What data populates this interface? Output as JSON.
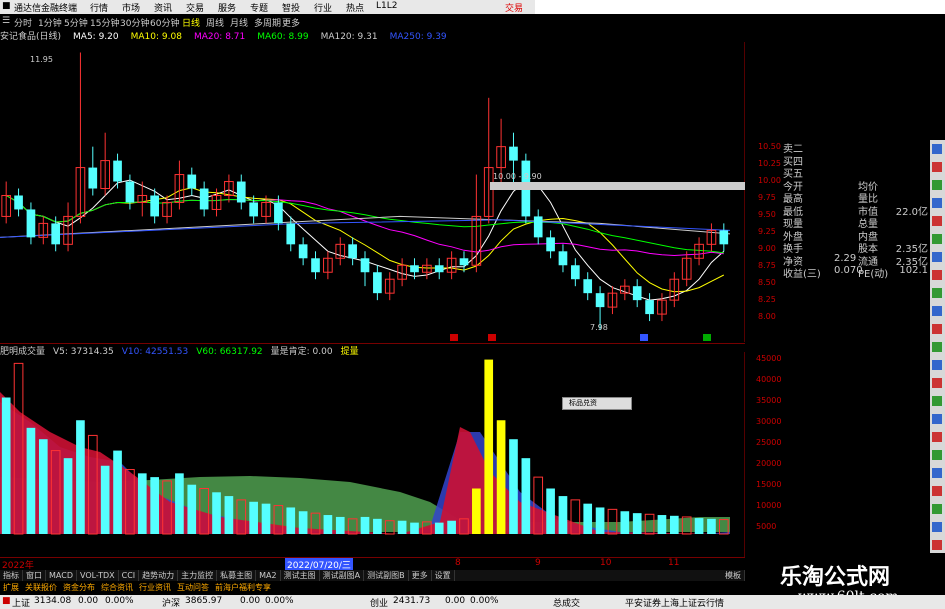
{
  "titlebar": {
    "app_title": "通达信金融终端",
    "menu": [
      "行情",
      "市场",
      "资讯",
      "交易",
      "服务",
      "专题",
      "智投",
      "行业",
      "热点",
      "L1L2"
    ],
    "trade_label": "交易"
  },
  "periods": [
    "分时",
    "1分钟",
    "5分钟",
    "15分钟",
    "30分钟",
    "60分钟",
    "日线",
    "周线",
    "月线",
    "多周期",
    "更多"
  ],
  "period_selected": "日线",
  "stock_label": "安记食品(日线)",
  "ma_items": [
    {
      "label": "MA5: 9.20",
      "color": "#ffffff"
    },
    {
      "label": "MA10: 9.08",
      "color": "#ffff00"
    },
    {
      "label": "MA20: 8.71",
      "color": "#ff00ff"
    },
    {
      "label": "MA60: 8.99",
      "color": "#00ff00"
    },
    {
      "label": "MA120: 9.31",
      "color": "#cccccc"
    },
    {
      "label": "MA250: 9.39",
      "color": "#3355ff"
    }
  ],
  "annotations": {
    "high": "11.95",
    "low": "7.98",
    "box": "10.00 - 9.90"
  },
  "kline_yaxis": [
    "10.50",
    "10.25",
    "10.00",
    "9.75",
    "9.50",
    "9.25",
    "9.00",
    "8.75",
    "8.50",
    "8.25",
    "8.00"
  ],
  "vol_header": [
    {
      "label": "肥明成交量",
      "color": "#cccccc"
    },
    {
      "label": "V5: 37314.35",
      "color": "#cccccc"
    },
    {
      "label": "V10: 42551.53",
      "color": "#3355ff"
    },
    {
      "label": "V60: 66317.92",
      "color": "#00ff00"
    },
    {
      "label": "量是肯定: 0.00",
      "color": "#cccccc"
    },
    {
      "label": "提量",
      "color": "#ffff00"
    }
  ],
  "vol_yaxis": [
    "45000",
    "40000",
    "35000",
    "30000",
    "25000",
    "20000",
    "15000",
    "10000",
    "5000"
  ],
  "popup_label": "标品兑资",
  "xaxis": {
    "labels": [
      "2022年",
      "8",
      "9",
      "10",
      "11"
    ],
    "highlight_date": "2022/07/20/三"
  },
  "indicator_tabs": [
    "指标",
    "窗口",
    "MACD",
    "VOL-TDX",
    "CCI",
    "趋势动力",
    "主力监控",
    "私募主图",
    "MA2",
    "测试主图",
    "测试副图A",
    "测试副图B",
    "更多",
    "设置"
  ],
  "indicator_right": "模板",
  "bottom_tabs": [
    "扩展",
    "关联报价",
    "资金分布",
    "综合资讯",
    "行业资讯",
    "互动问答",
    "前海户福利专享"
  ],
  "info_panel": [
    {
      "label": "卖二",
      "mid": "",
      "v1": "",
      "v2": ""
    },
    {
      "label": "买四",
      "mid": "",
      "v1": "",
      "v2": ""
    },
    {
      "label": "买五",
      "mid": "",
      "v1": "",
      "v2": ""
    },
    {
      "label": "今开",
      "mid": "均价",
      "v1": "",
      "v2": ""
    },
    {
      "label": "最高",
      "mid": "量比",
      "v1": "",
      "v2": ""
    },
    {
      "label": "最低",
      "mid": "市值",
      "v1": "",
      "v2": "22.0亿"
    },
    {
      "label": "现量",
      "mid": "总量",
      "v1": "",
      "v2": ""
    },
    {
      "label": "外盘",
      "mid": "内盘",
      "v1": "",
      "v2": ""
    },
    {
      "label": "换手",
      "mid": "股本",
      "v1": "",
      "v2": "2.35亿"
    },
    {
      "label": "净资",
      "mid": "流通",
      "v1": "2.29",
      "v2": "2.35亿"
    },
    {
      "label": "收益(三)",
      "mid": "PE(动)",
      "v1": "0.070",
      "v2": "102.1"
    }
  ],
  "status": {
    "sh_label": "上证",
    "sh_value": "3134.08",
    "sh_chg": "0.00",
    "sh_pct": "0.00%",
    "hs_label": "沪深",
    "hs_value": "3865.97",
    "hs_chg": "0.00",
    "hs_pct": "0.00%",
    "cy_label": "创业",
    "cy_value": "2431.73",
    "cy_chg": "0.00",
    "cy_pct": "0.00%",
    "vol_label": "总成交",
    "right_text": "平安证券上海上证云行情"
  },
  "watermark": {
    "line1": "乐淘公式网",
    "line2": "www.60lt.com"
  },
  "colors": {
    "up": "#ff3333",
    "down": "#55ffff",
    "bg": "#000000",
    "axis": "#aa0000"
  },
  "kline_data": {
    "type": "candlestick",
    "candles": [
      [
        9.6,
        9.9,
        9.5,
        10.1
      ],
      [
        9.9,
        9.7,
        9.6,
        10.0
      ],
      [
        9.7,
        9.3,
        9.2,
        9.8
      ],
      [
        9.3,
        9.5,
        9.2,
        9.6
      ],
      [
        9.5,
        9.2,
        9.1,
        9.6
      ],
      [
        9.2,
        9.6,
        9.1,
        9.8
      ],
      [
        9.6,
        10.3,
        9.5,
        11.95
      ],
      [
        10.3,
        10.0,
        9.9,
        10.6
      ],
      [
        10.0,
        10.4,
        9.9,
        10.8
      ],
      [
        10.4,
        10.1,
        10.0,
        10.5
      ],
      [
        10.1,
        9.8,
        9.7,
        10.2
      ],
      [
        9.8,
        9.9,
        9.6,
        10.1
      ],
      [
        9.9,
        9.6,
        9.5,
        10.0
      ],
      [
        9.6,
        9.8,
        9.5,
        9.9
      ],
      [
        9.8,
        10.2,
        9.7,
        10.4
      ],
      [
        10.2,
        10.0,
        9.9,
        10.3
      ],
      [
        10.0,
        9.7,
        9.6,
        10.1
      ],
      [
        9.7,
        9.9,
        9.6,
        10.0
      ],
      [
        9.9,
        10.1,
        9.8,
        10.2
      ],
      [
        10.1,
        9.8,
        9.7,
        10.2
      ],
      [
        9.8,
        9.6,
        9.5,
        9.9
      ],
      [
        9.6,
        9.8,
        9.5,
        9.9
      ],
      [
        9.8,
        9.5,
        9.4,
        9.9
      ],
      [
        9.5,
        9.2,
        9.1,
        9.6
      ],
      [
        9.2,
        9.0,
        8.9,
        9.3
      ],
      [
        9.0,
        8.8,
        8.7,
        9.1
      ],
      [
        8.8,
        9.0,
        8.7,
        9.1
      ],
      [
        9.0,
        9.2,
        8.9,
        9.3
      ],
      [
        9.2,
        9.0,
        8.9,
        9.3
      ],
      [
        9.0,
        8.8,
        8.6,
        9.1
      ],
      [
        8.8,
        8.5,
        8.4,
        8.9
      ],
      [
        8.5,
        8.7,
        8.4,
        8.8
      ],
      [
        8.7,
        8.9,
        8.6,
        9.0
      ],
      [
        8.9,
        8.8,
        8.7,
        9.0
      ],
      [
        8.8,
        8.9,
        8.7,
        9.0
      ],
      [
        8.9,
        8.8,
        8.7,
        9.0
      ],
      [
        8.8,
        9.0,
        8.7,
        9.1
      ],
      [
        9.0,
        8.9,
        8.8,
        9.1
      ],
      [
        8.9,
        9.6,
        8.8,
        10.2
      ],
      [
        9.6,
        10.3,
        9.5,
        11.3
      ],
      [
        10.3,
        10.6,
        10.0,
        11.0
      ],
      [
        10.6,
        10.4,
        10.0,
        10.8
      ],
      [
        10.4,
        9.6,
        9.5,
        10.5
      ],
      [
        9.6,
        9.3,
        9.2,
        9.7
      ],
      [
        9.3,
        9.1,
        9.0,
        9.4
      ],
      [
        9.1,
        8.9,
        8.8,
        9.2
      ],
      [
        8.9,
        8.7,
        8.6,
        9.0
      ],
      [
        8.7,
        8.5,
        8.4,
        8.8
      ],
      [
        8.5,
        8.3,
        7.98,
        8.6
      ],
      [
        8.3,
        8.5,
        8.2,
        8.6
      ],
      [
        8.5,
        8.6,
        8.4,
        8.7
      ],
      [
        8.6,
        8.4,
        8.3,
        8.7
      ],
      [
        8.4,
        8.2,
        8.1,
        8.5
      ],
      [
        8.2,
        8.4,
        8.1,
        8.5
      ],
      [
        8.4,
        8.7,
        8.3,
        8.8
      ],
      [
        8.7,
        9.0,
        8.6,
        9.1
      ],
      [
        9.0,
        9.2,
        8.9,
        9.3
      ],
      [
        9.2,
        9.4,
        9.1,
        9.5
      ],
      [
        9.4,
        9.2,
        9.1,
        9.5
      ]
    ]
  },
  "volume_data": {
    "type": "bar",
    "values": [
      36000,
      45000,
      28000,
      25000,
      22000,
      20000,
      30000,
      26000,
      18000,
      22000,
      17000,
      16000,
      15000,
      14000,
      16000,
      13000,
      12000,
      11000,
      10000,
      9000,
      8500,
      8000,
      7500,
      7000,
      6000,
      5500,
      5000,
      4500,
      4000,
      4500,
      4000,
      3500,
      3500,
      3000,
      3200,
      3000,
      3500,
      4000,
      12000,
      46000,
      30000,
      25000,
      20000,
      15000,
      12000,
      10000,
      9000,
      8000,
      7000,
      6500,
      6000,
      5500,
      5200,
      5000,
      4800,
      4500,
      4200,
      4000,
      3800
    ]
  }
}
